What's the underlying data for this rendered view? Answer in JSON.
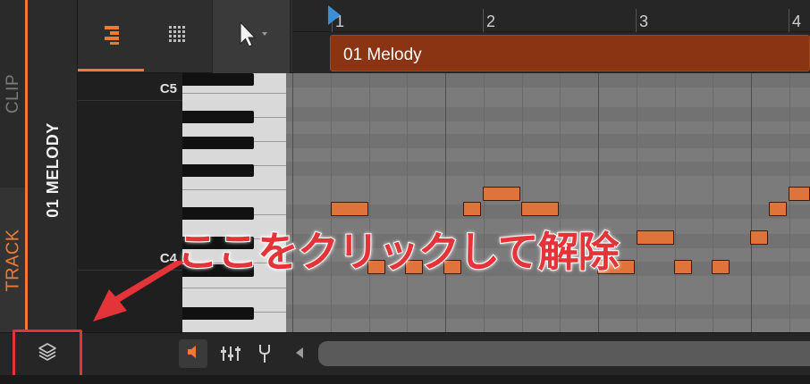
{
  "colors": {
    "accent_orange": "#f07a32",
    "clip_color": "#8a3414",
    "note_color": "#e0733a",
    "annotation_red": "#e5333a"
  },
  "side_tabs": {
    "clip": "CLIP",
    "track": "TRACK"
  },
  "track": {
    "name": "01 MELODY"
  },
  "toolbar": {
    "piano_roll_icon": "piano-roll-icon",
    "grid_icon": "drum-grid-icon",
    "pointer_icon": "pointer-tool-icon"
  },
  "ruler": {
    "bars": [
      "1",
      "2",
      "3",
      "4"
    ]
  },
  "clip": {
    "name": "01 Melody"
  },
  "note_names": {
    "c5": "C5",
    "c4": "C4"
  },
  "annotation": {
    "text": "ここをクリックして解除"
  },
  "bottom_bar": {
    "layers_icon": "layers-icon",
    "speaker_icon": "speaker-icon",
    "mixer_icon": "mixer-icon",
    "fork_icon": "fork-icon",
    "scroll_left_icon": "scroll-left-icon"
  }
}
